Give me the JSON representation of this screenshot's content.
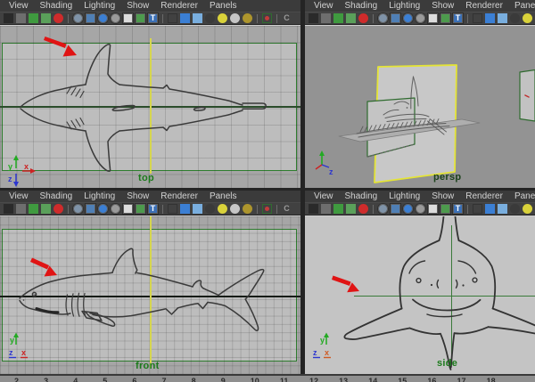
{
  "menu": {
    "items": [
      "View",
      "Shading",
      "Lighting",
      "Show",
      "Renderer",
      "Panels"
    ]
  },
  "toolbar": {
    "icons": [
      {
        "name": "camera-icon",
        "kind": "sq",
        "color": "#2a2a2a"
      },
      {
        "name": "camera-select-icon",
        "kind": "sq",
        "color": "#6e6e6e"
      },
      {
        "name": "bookmark-icon",
        "kind": "sq",
        "color": "#3f9a3f"
      },
      {
        "name": "image-plane-icon",
        "kind": "sq",
        "color": "#5aa05a"
      },
      {
        "name": "pin-icon",
        "kind": "rd",
        "color": "#cf2b2b"
      },
      {
        "name": "toolbar-separator",
        "kind": "sep"
      },
      {
        "name": "wireframe-sphere-icon",
        "kind": "rd btn",
        "color": "#7f93a8"
      },
      {
        "name": "film-gate-icon",
        "kind": "sq btn",
        "color": "#4f7fb5"
      },
      {
        "name": "shaded-sphere-icon",
        "kind": "rd btn",
        "color": "#3b7fd4"
      },
      {
        "name": "flat-sphere-icon",
        "kind": "rd btn",
        "color": "#9a9a9a"
      },
      {
        "name": "checker-icon",
        "kind": "sq btn",
        "color": "#dcdcdc"
      },
      {
        "name": "textured-icon",
        "kind": "sq btn",
        "color": "#4d9a4d"
      },
      {
        "name": "text-icon",
        "kind": "sq btn glyphbox",
        "color": "#3b6fb5",
        "glyph": "T",
        "glyph_color": "#ffffff"
      },
      {
        "name": "toolbar-separator",
        "kind": "sep"
      },
      {
        "name": "cube-outline-icon",
        "kind": "sq-outline",
        "color": "#333333"
      },
      {
        "name": "cube-blue-icon",
        "kind": "sq",
        "color": "#3b7fd4"
      },
      {
        "name": "cube-shaded-icon",
        "kind": "sq",
        "color": "#79aede"
      },
      {
        "name": "render-ball-icon",
        "kind": "rd",
        "color": "#3a3a3a"
      },
      {
        "name": "light-yellow-icon",
        "kind": "rd",
        "color": "#d9d23a"
      },
      {
        "name": "light-gray-icon",
        "kind": "rd",
        "color": "#c6c6c6"
      },
      {
        "name": "light-gold-icon",
        "kind": "rd",
        "color": "#ad952d"
      },
      {
        "name": "toolbar-separator",
        "kind": "sep"
      },
      {
        "name": "isolate-select-icon",
        "kind": "sq-outline-dot",
        "color": "#c23b3b"
      },
      {
        "name": "toolbar-separator",
        "kind": "sep"
      },
      {
        "name": "grease-pencil-icon",
        "kind": "glyph",
        "color": "#9a9a9a",
        "glyph": "C",
        "glyph_color": "#9a9a9a"
      }
    ]
  },
  "viewports": {
    "top": {
      "label": "top"
    },
    "persp": {
      "label": "persp"
    },
    "front": {
      "label": "front"
    },
    "side": {
      "label": "side"
    }
  },
  "axis": {
    "x": "x",
    "y": "y",
    "z": "z",
    "x_color": "#cc2222",
    "x_color_side": "#cf5a22",
    "y_color": "#22aa22",
    "z_color": "#2b35cf"
  },
  "timeline": {
    "numbers": [
      2,
      3,
      4,
      5,
      6,
      7,
      8,
      9,
      10,
      11,
      12,
      13,
      14,
      15,
      16,
      17,
      18
    ]
  },
  "colors": {
    "viewport_label_green": "#1b7a1b",
    "persp_label": "#1c421c",
    "image_plane_border": "#2e7d2e",
    "selected_plane_border": "#e4e436",
    "annotation_arrow": "#e01414",
    "ortho_bg": "#a6a6a6",
    "plane_bg": "#bdbdbd",
    "persp_bg": "#939393",
    "side_bg": "#c4c4c4",
    "menubar_bg": "#3b3b3b",
    "sketch_stroke": "#3a3a3a"
  }
}
